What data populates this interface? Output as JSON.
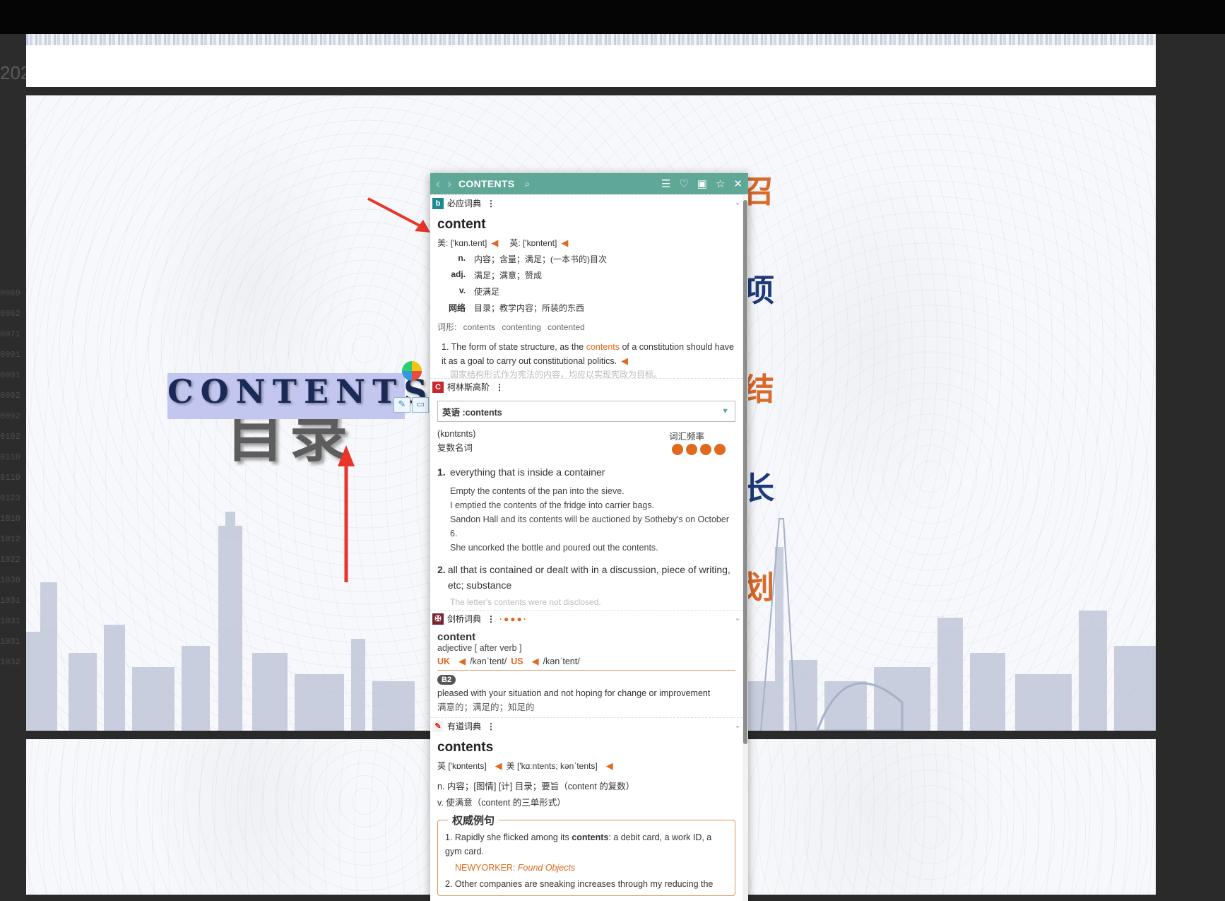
{
  "left_gutter": {
    "year": "202",
    "numbers": [
      "0069",
      "0062",
      "0071",
      "0091",
      "0091",
      "0092",
      "0092",
      "0102",
      "0110",
      "0110",
      "0123",
      "1010",
      "1012",
      "1022",
      "1030",
      "1031",
      "1031",
      "1031",
      "1032"
    ]
  },
  "slide": {
    "title_cn": "目录",
    "title_en": "CONTENTS",
    "right_chars": [
      "召",
      "项",
      "结",
      "长",
      "划"
    ],
    "colors": {
      "orange": "#d86a2a",
      "navy": "#1e3a7a",
      "highlight": "#c3c6ef"
    }
  },
  "dict": {
    "header": {
      "back": "‹",
      "forward": "›",
      "word": "CONTENTS",
      "search_icon": "search-icon",
      "tools": [
        "menu-icon",
        "heart-icon",
        "book-icon",
        "star-icon",
        "close-icon"
      ]
    },
    "bing": {
      "name": "必应词典",
      "headword": "content",
      "us_label": "美: ['kɑn.tent]",
      "uk_label": "英: ['kɒntent]",
      "senses": [
        {
          "pos": "n.",
          "text": "内容；含量；满足；(一本书的)目次"
        },
        {
          "pos": "adj.",
          "text": "满足；满意；赞成"
        },
        {
          "pos": "v.",
          "text": "使满足"
        },
        {
          "pos": "网络",
          "text": "目录；教学内容；所装的东西"
        }
      ],
      "forms": "词形: contents  contenting  contented",
      "example_pre": "1. The form of state structure, as the ",
      "example_hl": "contents",
      "example_post": " of a constitution should have it as a goal to carry out constitutional politics.",
      "example_cn": "国家结构形式作为宪法的内容，均应以实现宪政为目标。"
    },
    "collins": {
      "name": "柯林斯高阶",
      "select": "英语 :contents",
      "pron": "(kɒntɛnts)",
      "freq_label": "词汇频率",
      "pos": "复数名词",
      "freq_dots": 4,
      "def1_num": "1.",
      "def1": "everything that is inside a container",
      "examples1": [
        "Empty the contents of the pan into the sieve.",
        "I emptied the contents of the fridge into carrier bags.",
        "Sandon Hall and its contents will be auctioned by Sotheby's on October 6.",
        "She uncorked the bottle and poured out the contents."
      ],
      "def2_num": "2.",
      "def2": "all that is contained or dealt with in a discussion, piece of writing, etc; substance",
      "example2_faded": "The letter's contents were not disclosed."
    },
    "cambridge": {
      "name": "剑桥词典",
      "headword": "content",
      "pos": "adjective [ after verb ]",
      "uk": "UK",
      "uk_ipa": "/kənˈtent/",
      "us": "US",
      "us_ipa": "/kənˈtent/",
      "level": "B2",
      "def": "pleased with your situation and not hoping for change or improvement",
      "def_cn": "满意的；满足的；知足的"
    },
    "youdao": {
      "name": "有道词典",
      "headword": "contents",
      "uk": "英 ['kɒntents]",
      "us": "美 ['kɑːntents; kənˈtents]",
      "sense1": "n. 内容；[图情] [计] 目录；要旨（content 的复数）",
      "sense2": "v. 使满意（content 的三单形式）",
      "box_title": "权威例句",
      "ex1_pre": "1. Rapidly she flicked among its ",
      "ex1_bold": "contents",
      "ex1_post": ": a debit card, a work ID, a gym card.",
      "ex1_src_a": "NEWYORKER: ",
      "ex1_src_b": "Found Objects",
      "ex2": "2. Other companies are sneaking increases through my reducing the"
    }
  }
}
